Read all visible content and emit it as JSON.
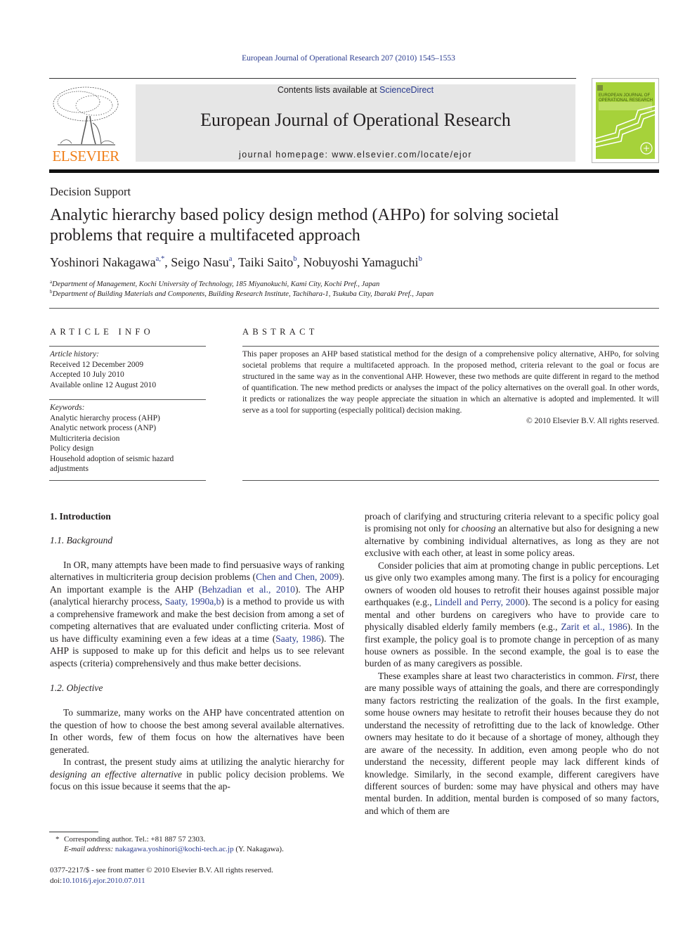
{
  "running_header": "European Journal of Operational Research 207 (2010) 1545–1553",
  "publisher": {
    "name": "ELSEVIER",
    "logo": "elsevier-tree-logo",
    "brand_color": "#f07f19"
  },
  "banner": {
    "contents_prefix": "Contents lists available at ",
    "contents_link": "ScienceDirect",
    "journal_title": "European Journal of Operational Research",
    "homepage_label": "journal homepage: www.elsevier.com/locate/ejor",
    "background": "#e6e6e6"
  },
  "cover": {
    "line1": "EUROPEAN JOURNAL OF",
    "line2": "OPERATIONAL RESEARCH",
    "color": "#a6d23a"
  },
  "article": {
    "section": "Decision Support",
    "title_line1": "Analytic hierarchy based policy design method (AHPo) for solving societal",
    "title_line2": "problems that require a multifaceted approach",
    "authors": [
      {
        "name": "Yoshinori Nakagawa",
        "sup": "a,*",
        "sep": ", "
      },
      {
        "name": "Seigo Nasu",
        "sup": "a",
        "sep": ", "
      },
      {
        "name": "Taiki Saito",
        "sup": "b",
        "sep": ", "
      },
      {
        "name": "Nobuyoshi Yamaguchi",
        "sup": "b",
        "sep": ""
      }
    ],
    "affiliations": [
      {
        "mark": "a",
        "text": "Department of Management, Kochi University of Technology, 185 Miyanokuchi, Kami City, Kochi Pref., Japan"
      },
      {
        "mark": "b",
        "text": "Department of Building Materials and Components, Building Research Institute, Tachihara-1, Tsukuba City, Ibaraki Pref., Japan"
      }
    ]
  },
  "article_info": {
    "heading": "ARTICLE INFO",
    "history_label": "Article history:",
    "history": [
      "Received 12 December 2009",
      "Accepted 10 July 2010",
      "Available online 12 August 2010"
    ],
    "keywords_label": "Keywords:",
    "keywords": [
      "Analytic hierarchy process (AHP)",
      "Analytic network process (ANP)",
      "Multicriteria decision",
      "Policy design",
      "Household adoption of seismic hazard adjustments"
    ]
  },
  "abstract": {
    "heading": "ABSTRACT",
    "text": "This paper proposes an AHP based statistical method for the design of a comprehensive policy alternative, AHPo, for solving societal problems that require a multifaceted approach. In the proposed method, criteria relevant to the goal or focus are structured in the same way as in the conventional AHP. However, these two methods are quite different in regard to the method of quantification. The new method predicts or analyses the impact of the policy alternatives on the overall goal. In other words, it predicts or rationalizes the way people appreciate the situation in which an alternative is adopted and implemented. It will serve as a tool for supporting (especially political) decision making.",
    "copyright": "© 2010 Elsevier B.V. All rights reserved."
  },
  "body": {
    "h1": "1. Introduction",
    "h2_background": "1.1. Background",
    "p1": [
      {
        "t": "In OR, many attempts have been made to find persuasive ways of ranking alternatives in multicriteria group decision problems ("
      },
      {
        "link": "Chen and Chen, 2009"
      },
      {
        "t": "). An important example is the AHP ("
      },
      {
        "link": "Behzadian et al., 2010"
      },
      {
        "t": "). The AHP (analytical hierarchy process, "
      },
      {
        "link": "Saaty, 1990a,b"
      },
      {
        "t": ") is a method to provide us with a comprehensive framework and make the best decision from among a set of competing alternatives that are evaluated under conflicting criteria. Most of us have difficulty examining even a few ideas at a time ("
      },
      {
        "link": "Saaty, 1986"
      },
      {
        "t": "). The AHP is supposed to make up for this deficit and helps us to see relevant aspects (criteria) comprehensively and thus make better decisions."
      }
    ],
    "h2_objective": "1.2. Objective",
    "p2": "To summarize, many works on the AHP have concentrated attention on the question of how to choose the best among several available alternatives. In other words, few of them focus on how the alternatives have been generated.",
    "p3": [
      {
        "t": "In contrast, the present study aims at utilizing the analytic hierarchy for "
      },
      {
        "em": "designing an effective alternative"
      },
      {
        "t": " in public policy decision problems. We focus on this issue because it seems that the ap-"
      }
    ],
    "p4": [
      {
        "t": "proach of clarifying and structuring criteria relevant to a specific policy goal is promising not only for "
      },
      {
        "em": "choosing"
      },
      {
        "t": " an alternative but also for designing a new alternative by combining individual alternatives, as long as they are not exclusive with each other, at least in some policy areas."
      }
    ],
    "p5": [
      {
        "t": "Consider policies that aim at promoting change in public perceptions. Let us give only two examples among many. The first is a policy for encouraging owners of wooden old houses to retrofit their houses against possible major earthquakes (e.g., "
      },
      {
        "link": "Lindell and Perry, 2000"
      },
      {
        "t": "). The second is a policy for easing mental and other burdens on caregivers who have to provide care to physically disabled elderly family members (e.g., "
      },
      {
        "link": "Zarit et al., 1986"
      },
      {
        "t": "). In the first example, the policy goal is to promote change in perception of as many house owners as possible. In the second example, the goal is to ease the burden of as many caregivers as possible."
      }
    ],
    "p6": [
      {
        "t": "These examples share at least two characteristics in common. "
      },
      {
        "em": "First"
      },
      {
        "t": ", there are many possible ways of attaining the goals, and there are correspondingly many factors restricting the realization of the goals. In the first example, some house owners may hesitate to retrofit their houses because they do not understand the necessity of retrofitting due to the lack of knowledge. Other owners may hesitate to do it because of a shortage of money, although they are aware of the necessity. In addition, even among people who do not understand the necessity, different people may lack different kinds of knowledge. Similarly, in the second example, different caregivers have different sources of burden: some may have physical and others may have mental burden. In addition, mental burden is composed of so many factors, and which of them are"
      }
    ]
  },
  "footnote": {
    "mark": "*",
    "corresponding": "Corresponding author. Tel.: +81 887 57 2303.",
    "email_label": "E-mail address:",
    "email": "nakagawa.yoshinori@kochi-tech.ac.jp",
    "email_suffix": " (Y. Nakagawa)."
  },
  "bottom": {
    "issn_line": "0377-2217/$ - see front matter © 2010 Elsevier B.V. All rights reserved.",
    "doi_label": "doi:",
    "doi": "10.1016/j.ejor.2010.07.011"
  },
  "colors": {
    "link": "#2a3b8f",
    "text": "#231f20"
  }
}
